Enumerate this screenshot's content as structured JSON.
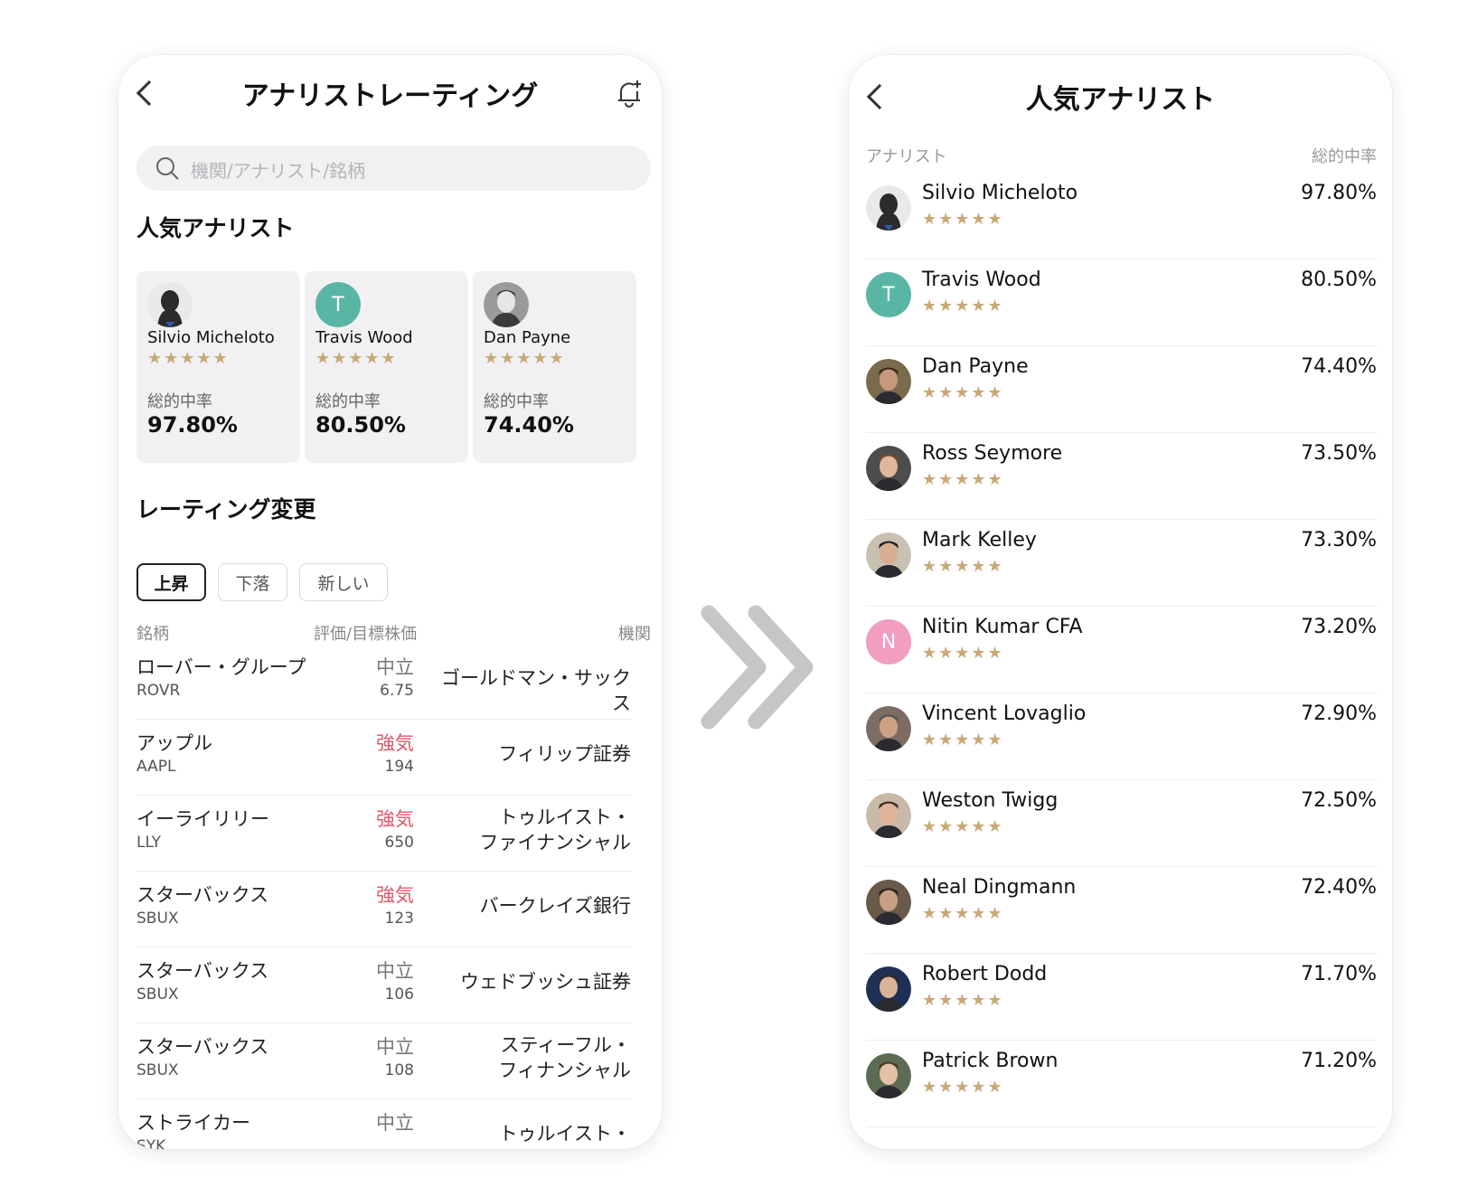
{
  "colors": {
    "star": "#c8a877",
    "bullish": "#e0566a",
    "teal_avatar": "#5ab6a4",
    "pink_avatar": "#f19ec1",
    "arrow": "#c6c6c6"
  },
  "left_screen": {
    "title": "アナリストレーティング",
    "search_placeholder": "機関/アナリスト/銘柄",
    "popular_section_title": "人気アナリスト",
    "popular_cards": [
      {
        "name": "Silvio Micheloto",
        "stars": "★★★★★",
        "rate_label": "総的中率",
        "rate": "97.80%",
        "avatar": "silhouette"
      },
      {
        "name": "Travis Wood",
        "stars": "★★★★★",
        "rate_label": "総的中率",
        "rate": "80.50%",
        "avatar": "letter",
        "initial": "T"
      },
      {
        "name": "Dan Payne",
        "stars": "★★★★★",
        "rate_label": "総的中率",
        "rate": "74.40%",
        "avatar": "photo"
      }
    ],
    "rating_section_title": "レーティング変更",
    "filters": [
      {
        "label": "上昇",
        "active": true
      },
      {
        "label": "下落",
        "active": false
      },
      {
        "label": "新しい",
        "active": false
      }
    ],
    "columns": {
      "stock": "銘柄",
      "rating": "評価/目標株価",
      "institution": "機関"
    },
    "rows": [
      {
        "name": "ローバー・グループ",
        "ticker": "ROVR",
        "rating": "中立",
        "bullish": false,
        "target": "6.75",
        "institution": "ゴールドマン・サックス"
      },
      {
        "name": "アップル",
        "ticker": "AAPL",
        "rating": "強気",
        "bullish": true,
        "target": "194",
        "institution": "フィリップ証券"
      },
      {
        "name": "イーライリリー",
        "ticker": "LLY",
        "rating": "強気",
        "bullish": true,
        "target": "650",
        "institution": "トゥルイスト・\nファイナンシャル"
      },
      {
        "name": "スターバックス",
        "ticker": "SBUX",
        "rating": "強気",
        "bullish": true,
        "target": "123",
        "institution": "バークレイズ銀行"
      },
      {
        "name": "スターバックス",
        "ticker": "SBUX",
        "rating": "中立",
        "bullish": false,
        "target": "106",
        "institution": "ウェドブッシュ証券"
      },
      {
        "name": "スターバックス",
        "ticker": "SBUX",
        "rating": "中立",
        "bullish": false,
        "target": "108",
        "institution": "スティーフル・\nフィナンシャル"
      },
      {
        "name": "ストライカー",
        "ticker": "SYK",
        "rating": "中立",
        "bullish": false,
        "target": "",
        "institution": "トゥルイスト・"
      }
    ]
  },
  "right_screen": {
    "title": "人気アナリスト",
    "header_left": "アナリスト",
    "header_right": "総的中率",
    "analysts": [
      {
        "name": "Silvio Micheloto",
        "rate": "97.80%",
        "stars": "★★★★★",
        "avatar": "silhouette"
      },
      {
        "name": "Travis Wood",
        "rate": "80.50%",
        "stars": "★★★★★",
        "avatar": "letter",
        "initial": "T",
        "color": "#5ab6a4"
      },
      {
        "name": "Dan Payne",
        "rate": "74.40%",
        "stars": "★★★★★",
        "avatar": "photo"
      },
      {
        "name": "Ross Seymore",
        "rate": "73.50%",
        "stars": "★★★★★",
        "avatar": "photo"
      },
      {
        "name": "Mark Kelley",
        "rate": "73.30%",
        "stars": "★★★★★",
        "avatar": "photo"
      },
      {
        "name": "Nitin Kumar CFA",
        "rate": "73.20%",
        "stars": "★★★★★",
        "avatar": "letter",
        "initial": "N",
        "color": "#f19ec1"
      },
      {
        "name": "Vincent Lovaglio",
        "rate": "72.90%",
        "stars": "★★★★★",
        "avatar": "photo"
      },
      {
        "name": "Weston Twigg",
        "rate": "72.50%",
        "stars": "★★★★★",
        "avatar": "photo"
      },
      {
        "name": "Neal Dingmann",
        "rate": "72.40%",
        "stars": "★★★★★",
        "avatar": "photo"
      },
      {
        "name": "Robert Dodd",
        "rate": "71.70%",
        "stars": "★★★★★",
        "avatar": "photo"
      },
      {
        "name": "Patrick Brown",
        "rate": "71.20%",
        "stars": "★★★★★",
        "avatar": "photo"
      }
    ]
  }
}
